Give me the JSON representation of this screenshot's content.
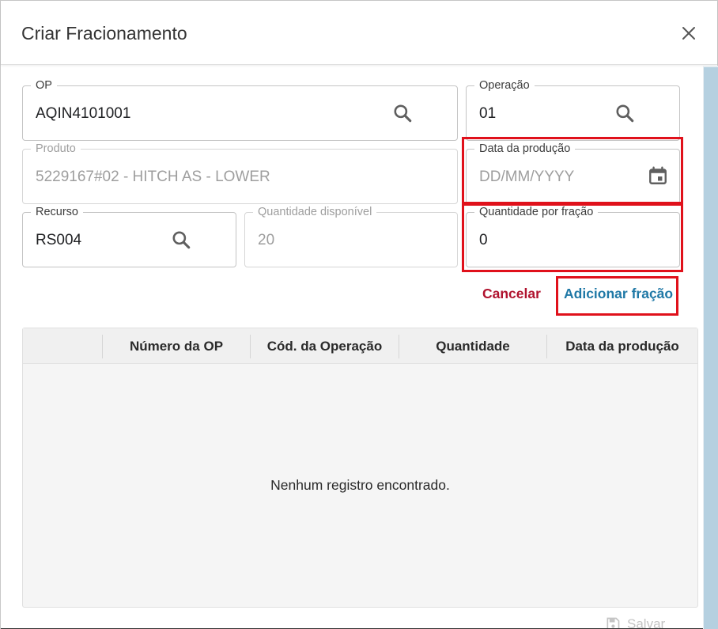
{
  "dialog": {
    "title": "Criar Fracionamento",
    "close_icon": "close-icon"
  },
  "form": {
    "op": {
      "label": "OP",
      "value": "AQIN4101001",
      "icon": "search-icon"
    },
    "operacao": {
      "label": "Operação",
      "value": "01",
      "icon": "search-icon"
    },
    "produto": {
      "label": "Produto",
      "value": "5229167#02 - HITCH AS - LOWER"
    },
    "data_producao": {
      "label": "Data da produção",
      "placeholder": "DD/MM/YYYY",
      "icon": "calendar-icon"
    },
    "recurso": {
      "label": "Recurso",
      "value": "RS004",
      "icon": "search-icon"
    },
    "quantidade_disponivel": {
      "label": "Quantidade disponível",
      "value": "20"
    },
    "quantidade_por_fracao": {
      "label": "Quantidade por fração",
      "value": "0"
    }
  },
  "actions": {
    "cancel_label": "Cancelar",
    "add_label": "Adicionar fração"
  },
  "table": {
    "columns": [
      "",
      "Número da OP",
      "Cód. da Operação",
      "Quantidade",
      "Data da produção"
    ],
    "empty_message": "Nenhum registro encontrado."
  },
  "footer": {
    "save_label": "Salvar",
    "save_icon": "save-icon"
  },
  "colors": {
    "highlight": "#e0111b",
    "cancel": "#b0122e",
    "primary": "#1f78a6"
  }
}
